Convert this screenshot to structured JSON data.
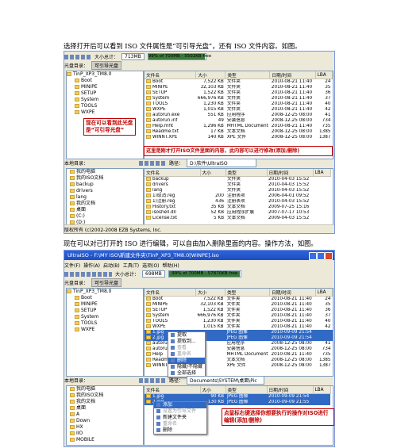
{
  "caption1": "选择打开后可以看到 ISO 文件属性是“可引导光盘”，还有 ISO 文件内容。如图。",
  "caption2": "现在可以对已打开的 ISO 进行编辑，可以自由加入删除里面的内容。操作方法，如图。",
  "shot1": {
    "toolbar": {
      "size_label": "大小总计：",
      "size_value": "713MB",
      "progress_text": "99% of 700MB - 5502KB free",
      "progress_value": 0.99
    },
    "disc_label": "光盘目录：",
    "disc_type": "可引导光盘",
    "tree_root": "TinP_XP3_TM8.0",
    "tree": [
      "Boot",
      "MINIPE",
      "SETUP",
      "System",
      "TOOLS",
      "WXPE"
    ],
    "columns": [
      "文件名",
      "大小",
      "类型",
      "日期/时间",
      "LBA"
    ],
    "files": [
      [
        "Boot",
        "7,522 KB",
        "文件夹",
        "2010-08-21 11:40",
        "24"
      ],
      [
        "MINIPE",
        "32,103 KB",
        "文件夹",
        "2010-08-21 11:40",
        "35"
      ],
      [
        "SETUP",
        "1,522 KB",
        "文件夹",
        "2010-08-21 11:40",
        "36"
      ],
      [
        "System",
        "666,976 KB",
        "文件夹",
        "2010-08-21 11:40",
        "37"
      ],
      [
        "TOOLS",
        "1,230 KB",
        "文件夹",
        "2010-08-21 11:40",
        "40"
      ],
      [
        "WXPE",
        "1,015 KB",
        "文件夹",
        "2010-08-21 11:40",
        "42"
      ],
      [
        "autorun.exe",
        "551 KB",
        "应用程序",
        "2008-12-25 08:00",
        "41"
      ],
      [
        "autorun.inf",
        "49",
        "安装信息",
        "2008-12-25 08:00",
        "734"
      ],
      [
        "Help.mht",
        "1,296 KB",
        "MHTML Document",
        "2010-08-21 11:40",
        "735"
      ],
      [
        "Readme.txt",
        "17 KB",
        "文本文档",
        "2008-12-25 08:00",
        "1385"
      ],
      [
        "WINNT.XPE",
        "140 KB",
        "XPE 文件",
        "2008-12-25 08:00",
        "1387"
      ]
    ],
    "annotation_left": "现在可以看到此光盘是“可引导光盘”",
    "annotation_right": "这里是刚才打开ISO文件里面的内容，此内容可以进行修改(添加/删除)",
    "local_label": "本地目录：",
    "path_label": "路径：",
    "path_value": "D:\\软件\\UltraISO",
    "local_tree": [
      "我的电脑",
      "我的ISO文档",
      "backup",
      "drivers",
      "lang",
      "我的文档",
      "桌面",
      "(C:)",
      "(D:)",
      "(E:)"
    ],
    "local_files": [
      [
        "backup",
        "",
        "文件夹",
        "2010-04-03 15:52",
        ""
      ],
      [
        "drivers",
        "",
        "文件夹",
        "2010-04-03 15:52",
        ""
      ],
      [
        "lang",
        "",
        "文件夹",
        "2010-04-03 15:52",
        ""
      ],
      [
        "1)取消.reg",
        "200",
        "注册表项",
        "2006-04-01 09:52",
        ""
      ],
      [
        "1)注册.reg",
        "436",
        "注册表项",
        "2010-04-03 15:52",
        ""
      ],
      [
        "History.txt",
        "35 KB",
        "文本文档",
        "2009-07-25 15:16",
        ""
      ],
      [
        "isoshell.dll",
        "52 KB",
        "应用程序扩展",
        "2007-07-17 10:53",
        ""
      ],
      [
        "License.txt",
        "5 KB",
        "文本文档",
        "2009-04-03 15:52",
        ""
      ]
    ],
    "status_left": "版权所有 (c)2002-2008 EZB Systems, Inc."
  },
  "shot2": {
    "title": "UltraISO - F:\\MY ISO\\新建文件夹\\TinP_XP3_TM8.0[WINPE].iso",
    "menu": [
      "文件(F)",
      "操作(A)",
      "启动(B)",
      "工具(T)",
      "选项(O)",
      "帮助(H)"
    ],
    "toolbar": {
      "size_label": "大小总计：",
      "size_value": "698MB",
      "progress_text": "99% of 700MB - 57870KB free",
      "progress_value": 0.99
    },
    "disc_label": "光盘目录：",
    "disc_type": "可引导光盘",
    "tree_root": "TinP_XP3_TM8.0",
    "tree": [
      "Boot",
      "MINIPE",
      "SETUP",
      "System",
      "TOOLS",
      "WXPE"
    ],
    "columns": [
      "文件名",
      "大小",
      "类型",
      "日期/时间",
      "LBA"
    ],
    "files": [
      [
        "Boot",
        "7,522 KB",
        "文件夹",
        "2010-08-21 11:40",
        "24"
      ],
      [
        "MINIPE",
        "32,103 KB",
        "文件夹",
        "2010-08-21 11:40",
        "35"
      ],
      [
        "SETUP",
        "1,522 KB",
        "文件夹",
        "2010-08-21 11:40",
        "36"
      ],
      [
        "System",
        "666,976 KB",
        "文件夹",
        "2010-08-21 11:40",
        "37"
      ],
      [
        "TOOLS",
        "1,230 KB",
        "文件夹",
        "2010-08-21 11:40",
        "40"
      ],
      [
        "WXPE",
        "1,015 KB",
        "文件夹",
        "2010-08-21 11:40",
        "42"
      ],
      [
        "1.jpg",
        "",
        "JPEG 图像",
        "2010-09-09 21:54",
        ""
      ],
      [
        "2.jpg",
        "",
        "JPEG 图像",
        "2010-09-09 21:54",
        ""
      ],
      [
        "autorun",
        "",
        "应用程序",
        "2008-12-25 08:00",
        "41"
      ],
      [
        "autorun",
        "",
        "安装信息",
        "2008-12-25 08:00",
        "734"
      ],
      [
        "Help",
        "",
        "MHTML Document",
        "2010-08-21 11:40",
        "735"
      ],
      [
        "Readme",
        "",
        "文本文档",
        "2008-12-25 08:00",
        "1385"
      ],
      [
        "WINNT",
        "",
        "XPE 文件",
        "2008-12-25 08:00",
        "1387"
      ]
    ],
    "context_menu": [
      "提取",
      "提取到...",
      "查看",
      "重命名",
      "删除",
      "隐藏/不隐藏",
      "全部选择"
    ],
    "local_label": "本地目录：",
    "path_label": "路径：",
    "path_value": "Documents\\SYSTEM\\桌面\\Pic",
    "local_tree": [
      "我的电脑",
      "我的ISO文档",
      "我的文档",
      "桌面",
      "A",
      "Down",
      "HX",
      "IIO",
      "MOBILE"
    ],
    "local_files": [
      [
        "1.jpg",
        "90 KB",
        "JPEG 图像",
        "2010-09-09 21:54",
        ""
      ],
      [
        "2.jpg",
        "130 KB",
        "JPEG 图像",
        "2010-09-09 21:55",
        ""
      ]
    ],
    "local_menu": [
      "添加",
      "设置为引导文件",
      "新建文件夹",
      "重命名",
      "删除"
    ],
    "annotation": "点鼠标右键选择你想要执行的操作对ISO进行编辑(添加/删除)"
  }
}
